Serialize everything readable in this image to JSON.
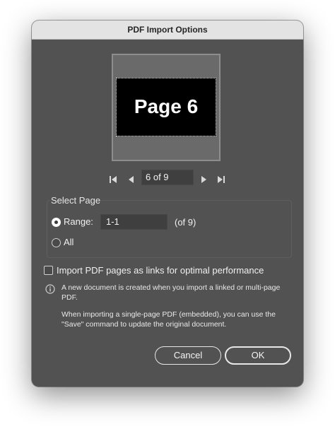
{
  "dialog": {
    "title": "PDF Import Options"
  },
  "preview": {
    "page_label": "Page 6"
  },
  "navigation": {
    "current_page": "6 of 9",
    "first_icon": "first-page-icon",
    "prev_icon": "previous-page-icon",
    "next_icon": "next-page-icon",
    "last_icon": "last-page-icon"
  },
  "select_page": {
    "title": "Select Page",
    "range_label": "Range:",
    "range_value": "1-1",
    "range_total": "(of 9)",
    "all_label": "All",
    "selected": "range"
  },
  "options": {
    "link_checkbox_label": "Import PDF pages as links for optimal performance",
    "link_checked": false
  },
  "info": {
    "icon": "info-icon",
    "text1": "A new document is created when you import a linked or multi-page PDF.",
    "text2": "When importing a single-page PDF (embedded), you can use the \"Save\" command to update the original document."
  },
  "buttons": {
    "cancel": "Cancel",
    "ok": "OK"
  },
  "colors": {
    "dialog_bg": "#525252",
    "titlebar_bg": "#e3e3e3",
    "field_bg": "#3f3f3f"
  }
}
